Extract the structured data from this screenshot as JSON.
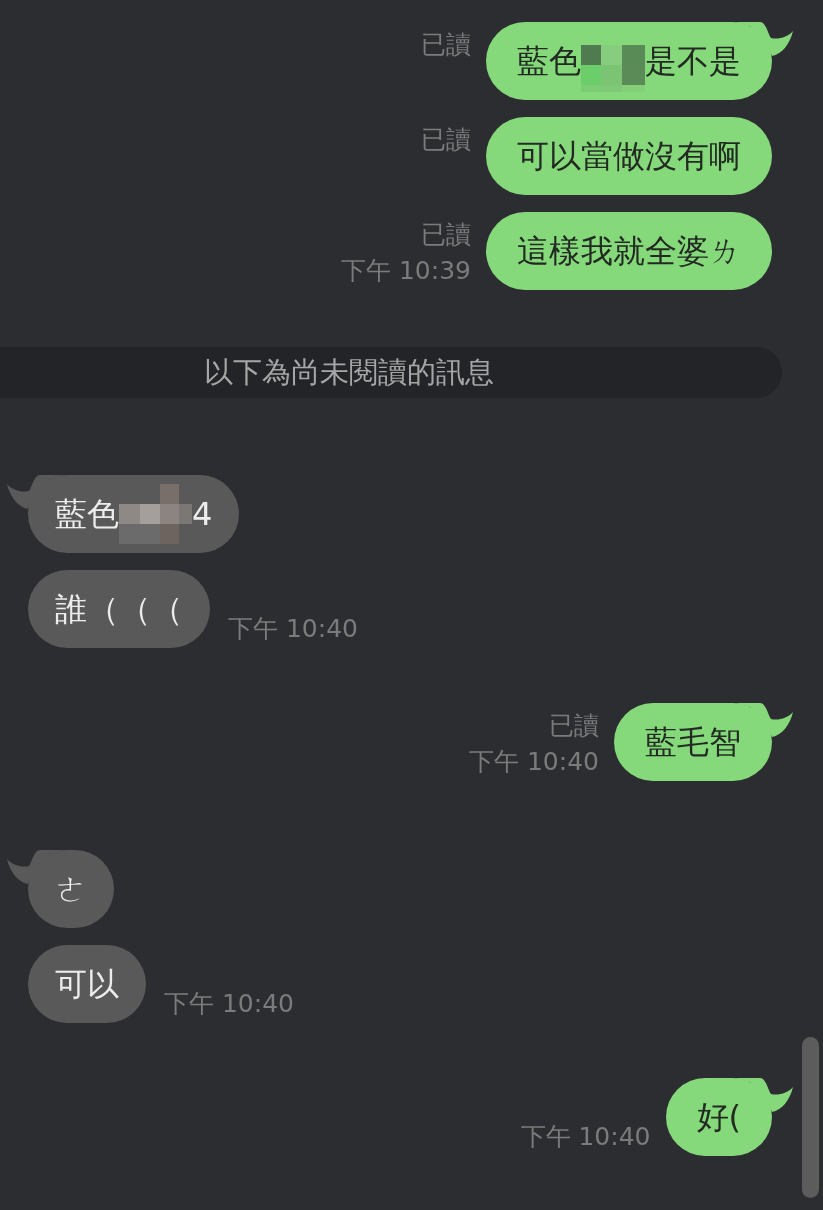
{
  "chat": {
    "entries": [
      {
        "kind": "sent",
        "messages": [
          {
            "receipt": "已讀",
            "segments": [
              {
                "kind": "text",
                "text": "藍色"
              },
              {
                "kind": "mosaic"
              },
              {
                "kind": "text",
                "text": "是不是"
              }
            ]
          },
          {
            "receipt": "已讀",
            "segments": [
              {
                "kind": "text",
                "text": "可以當做沒有啊"
              }
            ]
          },
          {
            "receipt": "已讀",
            "segments": [
              {
                "kind": "text",
                "text": "這樣我就全婆ㄌ"
              }
            ]
          }
        ],
        "time": "下午 10:39"
      },
      {
        "kind": "divider",
        "text": "以下為尚未閱讀的訊息"
      },
      {
        "kind": "received",
        "messages": [
          {
            "segments": [
              {
                "kind": "text",
                "text": "藍色"
              },
              {
                "kind": "mosaic"
              },
              {
                "kind": "text",
                "text": "4"
              }
            ]
          },
          {
            "segments": [
              {
                "kind": "text",
                "text": "誰（（（"
              }
            ]
          }
        ],
        "time": "下午 10:40"
      },
      {
        "kind": "sent",
        "messages": [
          {
            "receipt": "已讀",
            "segments": [
              {
                "kind": "text",
                "text": "藍毛智"
              }
            ]
          }
        ],
        "time": "下午 10:40"
      },
      {
        "kind": "received",
        "messages": [
          {
            "segments": [
              {
                "kind": "text",
                "text": "ㄜ"
              }
            ]
          },
          {
            "segments": [
              {
                "kind": "text",
                "text": "可以"
              }
            ]
          }
        ],
        "time": "下午 10:40"
      },
      {
        "kind": "sent",
        "messages": [
          {
            "segments": [
              {
                "kind": "text",
                "text": "好("
              }
            ]
          }
        ],
        "time": "下午 10:40"
      }
    ]
  }
}
